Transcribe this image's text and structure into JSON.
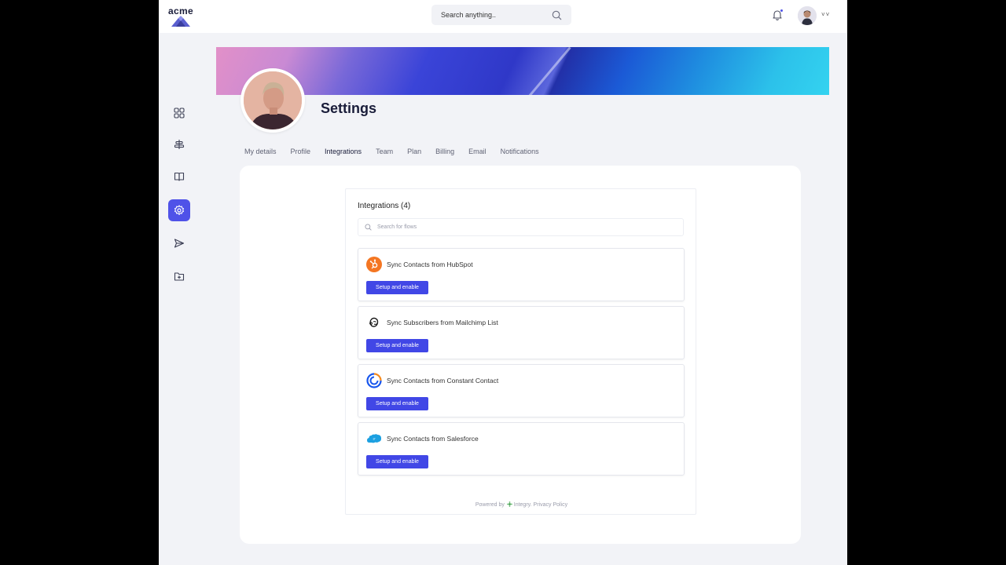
{
  "header": {
    "logo_text": "acme",
    "search_placeholder": "Search anything..",
    "user_menu_caret": "˅˅"
  },
  "sidebar": {
    "items": [
      {
        "name": "dashboard-icon",
        "active": false
      },
      {
        "name": "align-center-icon",
        "active": false
      },
      {
        "name": "book-icon",
        "active": false
      },
      {
        "name": "gear-icon",
        "active": true
      },
      {
        "name": "send-icon",
        "active": false
      },
      {
        "name": "folder-plus-icon",
        "active": false
      }
    ]
  },
  "page": {
    "title": "Settings",
    "tabs": [
      {
        "label": "My details",
        "active": false
      },
      {
        "label": "Profile",
        "active": false
      },
      {
        "label": "Integrations",
        "active": true
      },
      {
        "label": "Team",
        "active": false
      },
      {
        "label": "Plan",
        "active": false
      },
      {
        "label": "Billing",
        "active": false
      },
      {
        "label": "Email",
        "active": false
      },
      {
        "label": "Notifications",
        "active": false
      }
    ]
  },
  "integrations": {
    "title": "Integrations (4)",
    "search_placeholder": "Search for flows",
    "items": [
      {
        "name": "Sync Contacts from HubSpot",
        "icon": "hubspot-icon",
        "button": "Setup and enable"
      },
      {
        "name": "Sync Subscribers from Mailchimp List",
        "icon": "mailchimp-icon",
        "button": "Setup and enable"
      },
      {
        "name": "Sync Contacts from Constant Contact",
        "icon": "constant-contact-icon",
        "button": "Setup and enable"
      },
      {
        "name": "Sync Contacts from Salesforce",
        "icon": "salesforce-icon",
        "button": "Setup and enable"
      }
    ],
    "footer": {
      "powered_by": "Powered by",
      "brand": "Integry",
      "privacy": "Privacy Policy"
    }
  },
  "colors": {
    "accent": "#4f52e8",
    "button": "#4147e6",
    "hubspot": "#f47622",
    "constant_contact": "#1856ed",
    "salesforce": "#1ca0e1"
  }
}
